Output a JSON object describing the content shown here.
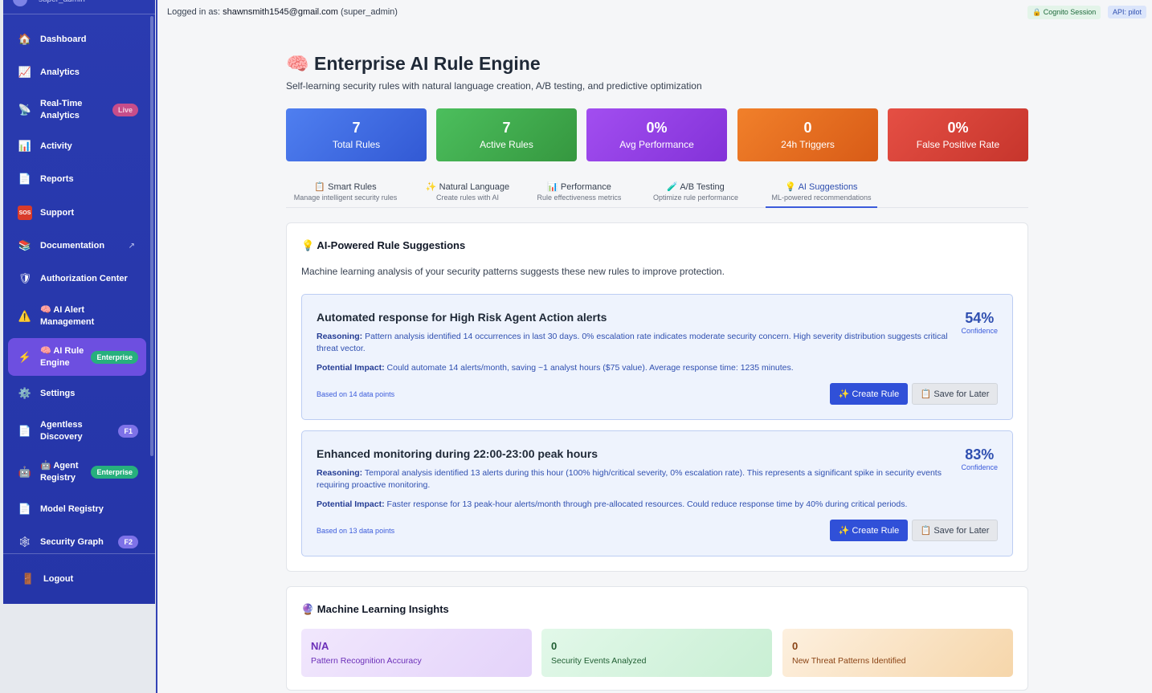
{
  "sidebar": {
    "user_role": "super_admin",
    "items": [
      {
        "label": "Dashboard",
        "icon": "🏠",
        "icon_name": "house-icon"
      },
      {
        "label": "Analytics",
        "icon": "📈",
        "icon_name": "chart-up-icon"
      },
      {
        "label": "Real-Time Analytics",
        "icon": "📡",
        "icon_name": "satellite-icon",
        "badge": "Live"
      },
      {
        "label": "Activity",
        "icon": "📊",
        "icon_name": "bar-chart-icon"
      },
      {
        "label": "Reports",
        "icon": "📄",
        "icon_name": "document-icon"
      },
      {
        "label": "Support",
        "icon": "SOS",
        "icon_name": "sos-icon"
      },
      {
        "label": "Documentation",
        "icon": "📚",
        "icon_name": "books-icon",
        "external": "↗"
      },
      {
        "label": "Authorization Center",
        "icon": "🛡",
        "icon_name": "shield-icon"
      },
      {
        "label": "🧠 AI Alert Management",
        "icon": "⚠️",
        "icon_name": "warning-icon"
      },
      {
        "label": "🧠 AI Rule Engine",
        "icon": "⚡",
        "icon_name": "lightning-icon",
        "badge": "Enterprise"
      },
      {
        "label": "Settings",
        "icon": "⚙️",
        "icon_name": "gear-icon"
      },
      {
        "label": "Agentless Discovery",
        "icon": "📄",
        "icon_name": "document-icon",
        "badge": "F1"
      },
      {
        "label": "🤖 Agent Registry",
        "icon": "🤖",
        "icon_name": "robot-icon",
        "badge": "Enterprise"
      },
      {
        "label": "Model Registry",
        "icon": "📄",
        "icon_name": "document-icon"
      },
      {
        "label": "Security Graph",
        "icon": "🕸",
        "icon_name": "network-icon",
        "badge": "F2"
      }
    ],
    "logout_label": "Logout",
    "logout_icon": "🚪"
  },
  "header": {
    "logged_in_prefix": "Logged in as:",
    "email": "shawnsmith1545@gmail.com",
    "role": "(super_admin)",
    "session_pill": "🔒 Cognito Session",
    "api_pill": "API: pilot"
  },
  "page": {
    "title": "🧠 Enterprise AI Rule Engine",
    "subtitle": "Self-learning security rules with natural language creation, A/B testing, and predictive optimization"
  },
  "stats": [
    {
      "value": "7",
      "label": "Total Rules"
    },
    {
      "value": "7",
      "label": "Active Rules"
    },
    {
      "value": "0%",
      "label": "Avg Performance"
    },
    {
      "value": "0",
      "label": "24h Triggers"
    },
    {
      "value": "0%",
      "label": "False Positive Rate"
    }
  ],
  "tabs": [
    {
      "label": "📋 Smart Rules",
      "sub": "Manage intelligent security rules"
    },
    {
      "label": "✨ Natural Language",
      "sub": "Create rules with AI"
    },
    {
      "label": "📊 Performance",
      "sub": "Rule effectiveness metrics"
    },
    {
      "label": "🧪 A/B Testing",
      "sub": "Optimize rule performance"
    },
    {
      "label": "💡 AI Suggestions",
      "sub": "ML-powered recommendations"
    }
  ],
  "suggestions_card": {
    "heading": "💡 AI-Powered Rule Suggestions",
    "description": "Machine learning analysis of your security patterns suggests these new rules to improve protection.",
    "reasoning_label": "Reasoning:",
    "impact_label": "Potential Impact:",
    "create_label": "✨ Create Rule",
    "save_label": "📋 Save for Later",
    "confidence_label": "Confidence",
    "items": [
      {
        "title": "Automated response for High Risk Agent Action alerts",
        "confidence": "54%",
        "reasoning": "Pattern analysis identified 14 occurrences in last 30 days. 0% escalation rate indicates moderate security concern. High severity distribution suggests critical threat vector.",
        "impact": "Could automate 14 alerts/month, saving ~1 analyst hours ($75 value). Average response time: 1235 minutes.",
        "based_on": "Based on 14 data points"
      },
      {
        "title": "Enhanced monitoring during 22:00-23:00 peak hours",
        "confidence": "83%",
        "reasoning": "Temporal analysis identified 13 alerts during this hour (100% high/critical severity, 0% escalation rate). This represents a significant spike in security events requiring proactive monitoring.",
        "impact": "Faster response for 13 peak-hour alerts/month through pre-allocated resources. Could reduce response time by 40% during critical periods.",
        "based_on": "Based on 13 data points"
      }
    ]
  },
  "insights_card": {
    "heading": "🔮 Machine Learning Insights",
    "items": [
      {
        "value": "N/A",
        "label": "Pattern Recognition Accuracy"
      },
      {
        "value": "0",
        "label": "Security Events Analyzed"
      },
      {
        "value": "0",
        "label": "New Threat Patterns Identified"
      }
    ]
  }
}
